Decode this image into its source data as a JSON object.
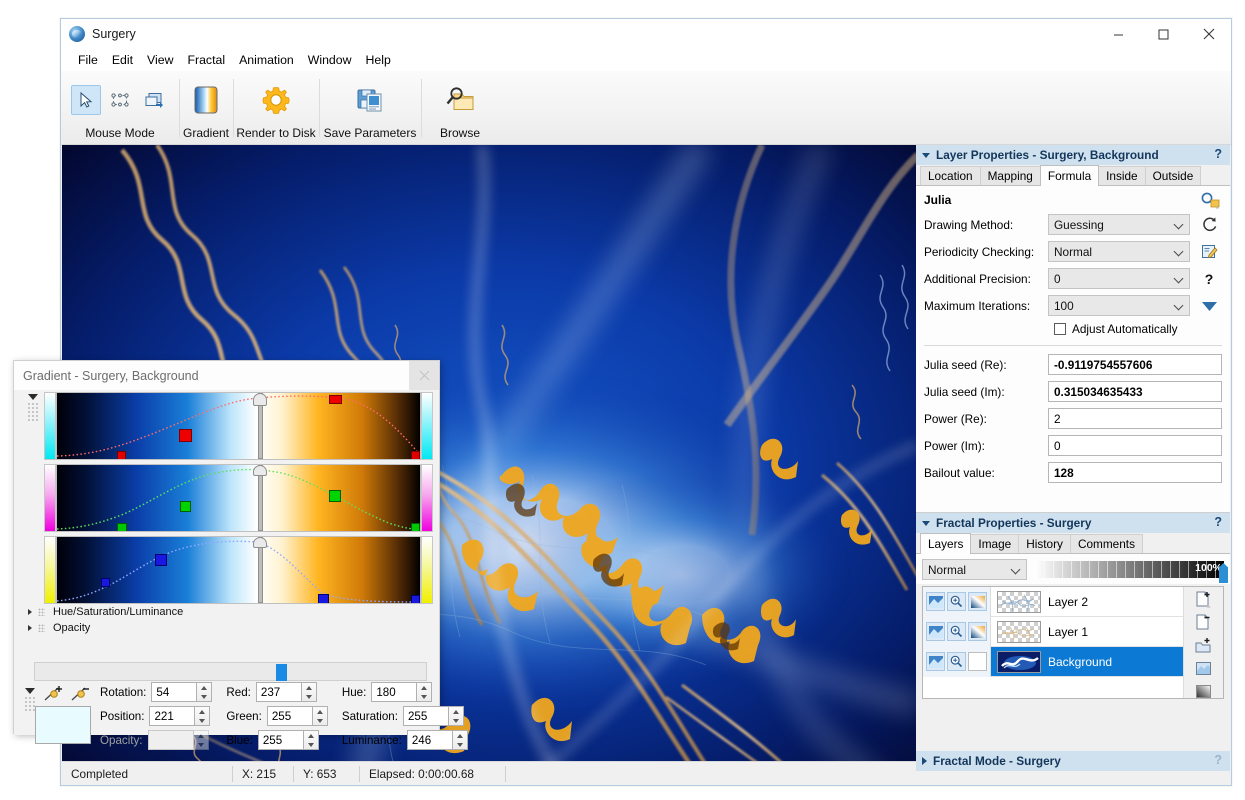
{
  "window": {
    "title": "Surgery",
    "icon": "app-globe-icon",
    "minimize": "minimize-icon",
    "maximize": "maximize-icon",
    "close": "close-icon"
  },
  "menu": {
    "items": [
      "File",
      "Edit",
      "View",
      "Fractal",
      "Animation",
      "Window",
      "Help"
    ]
  },
  "toolbar": {
    "groups": [
      {
        "label": "Mouse Mode",
        "icons": [
          "cursor-arrow-icon",
          "selection-box-icon",
          "layer-switch-icon"
        ]
      },
      {
        "label": "Gradient",
        "icons": [
          "gradient-swatch-icon"
        ]
      },
      {
        "label": "Render to Disk",
        "icons": [
          "gear-icon"
        ]
      },
      {
        "label": "Save Parameters",
        "icons": [
          "save-floppy-icon"
        ]
      },
      {
        "label": "Browse",
        "icons": [
          "browse-folder-magnifier-icon"
        ]
      }
    ]
  },
  "status_bar": {
    "state": "Completed",
    "x": "X: 215",
    "y": "Y: 653",
    "elapsed": "Elapsed: 0:00:00.68"
  },
  "layer_properties": {
    "header": "Layer Properties - Surgery, Background",
    "help": "?",
    "tabs": [
      "Location",
      "Mapping",
      "Formula",
      "Inside",
      "Outside"
    ],
    "selected_tab": "Formula",
    "formula_name": "Julia",
    "side_icons": [
      "browse-formula-icon",
      "reload-icon",
      "edit-formula-icon",
      "help-icon",
      "expand-down-icon"
    ],
    "fields": [
      {
        "label": "Drawing Method:",
        "value": "Guessing",
        "type": "combo"
      },
      {
        "label": "Periodicity Checking:",
        "value": "Normal",
        "type": "combo"
      },
      {
        "label": "Additional Precision:",
        "value": "0",
        "type": "combo"
      },
      {
        "label": "Maximum Iterations:",
        "value": "100",
        "type": "combo"
      }
    ],
    "checkbox": {
      "label": "Adjust Automatically",
      "checked": false
    },
    "params": [
      {
        "label": "Julia seed (Re):",
        "value": "-0.9119754557606",
        "bold": true
      },
      {
        "label": "Julia seed (Im):",
        "value": "0.315034635433",
        "bold": true
      },
      {
        "label": "Power (Re):",
        "value": "2",
        "bold": false
      },
      {
        "label": "Power (Im):",
        "value": "0",
        "bold": false
      },
      {
        "label": "Bailout value:",
        "value": "128",
        "bold": true
      }
    ]
  },
  "fractal_properties": {
    "header": "Fractal Properties - Surgery",
    "help": "?",
    "tabs": [
      "Layers",
      "Image",
      "History",
      "Comments"
    ],
    "selected_tab": "Layers",
    "blend_mode": "Normal",
    "opacity": "100%",
    "layers": [
      {
        "name": "Layer 2",
        "visible": true,
        "zoom": true,
        "mask": true,
        "selected": false,
        "thumb": "thumb-layer2"
      },
      {
        "name": "Layer 1",
        "visible": true,
        "zoom": true,
        "mask": true,
        "selected": false,
        "thumb": "thumb-layer1"
      },
      {
        "name": "Background",
        "visible": true,
        "zoom": true,
        "mask": false,
        "selected": true,
        "thumb": "thumb-background"
      }
    ],
    "side_buttons": [
      "add-layer-icon",
      "delete-layer-icon",
      "add-group-icon",
      "duplicate-layer-icon",
      "layer-mask-icon"
    ]
  },
  "fractal_mode": {
    "header": "Fractal Mode - Surgery",
    "help": "?"
  },
  "gradient_dialog": {
    "title": "Gradient - Surgery, Background",
    "close": "close-icon",
    "curves": [
      {
        "name": "red-curve",
        "color": "#e00000",
        "cap": "#00e8f2"
      },
      {
        "name": "green-curve",
        "color": "#00c000",
        "cap": "#f000e0"
      },
      {
        "name": "blue-curve",
        "color": "#1818e0",
        "cap": "#f0f000"
      }
    ],
    "tree": [
      {
        "label": "Hue/Saturation/Luminance"
      },
      {
        "label": "Opacity"
      }
    ],
    "position_slider": {
      "value": 221,
      "max": 400
    },
    "tool_icons": [
      "add-control-point-icon",
      "remove-control-point-icon"
    ],
    "swatch_color": "#e8fbff",
    "numeric_fields": [
      {
        "label": "Rotation:",
        "mnemonic": "R",
        "value": "54",
        "disabled": false
      },
      {
        "label": "Red:",
        "mnemonic": "R",
        "value": "237",
        "disabled": false
      },
      {
        "label": "Hue:",
        "mnemonic": "H",
        "value": "180",
        "disabled": false
      },
      {
        "label": "Position:",
        "mnemonic": "P",
        "value": "221",
        "disabled": false
      },
      {
        "label": "Green:",
        "mnemonic": "G",
        "value": "255",
        "disabled": false
      },
      {
        "label": "Saturation:",
        "mnemonic": "S",
        "value": "255",
        "disabled": false
      },
      {
        "label": "Opacity:",
        "mnemonic": "O",
        "value": "",
        "disabled": true
      },
      {
        "label": "Blue:",
        "mnemonic": "B",
        "value": "255",
        "disabled": false
      },
      {
        "label": "Luminance:",
        "mnemonic": "L",
        "value": "246",
        "disabled": false
      }
    ]
  },
  "colors": {
    "accent": "#0c7ad4",
    "panel_header": "#cfe0ef",
    "selection": "#0c7ad4",
    "toolbar_active": "#cfe6f8"
  }
}
